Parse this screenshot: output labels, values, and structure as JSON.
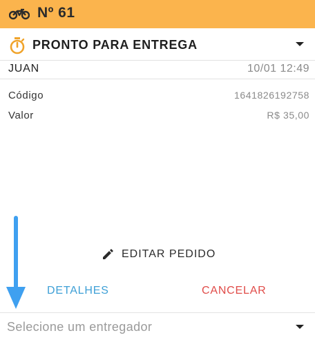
{
  "header": {
    "order_label": "Nº 61",
    "icon": "motorcycle-icon",
    "bg_color": "#fbb44d"
  },
  "status": {
    "label": "PRONTO PARA ENTREGA",
    "icon": "stopwatch-icon",
    "icon_color": "#f0a32a"
  },
  "customer": {
    "name": "JUAN",
    "datetime": "10/01 12:49"
  },
  "fields": [
    {
      "key": "Código",
      "value": "1641826192758"
    },
    {
      "key": "Valor",
      "value": "R$ 35,00"
    }
  ],
  "actions": {
    "edit_label": "EDITAR PEDIDO",
    "details_label": "DETALHES",
    "cancel_label": "CANCELAR",
    "details_color": "#3d9fd6",
    "cancel_color": "#e04b48"
  },
  "courier_select": {
    "placeholder": "Selecione um entregador"
  },
  "annotation": {
    "icon": "down-arrow-icon",
    "color": "#3fa0f0"
  }
}
